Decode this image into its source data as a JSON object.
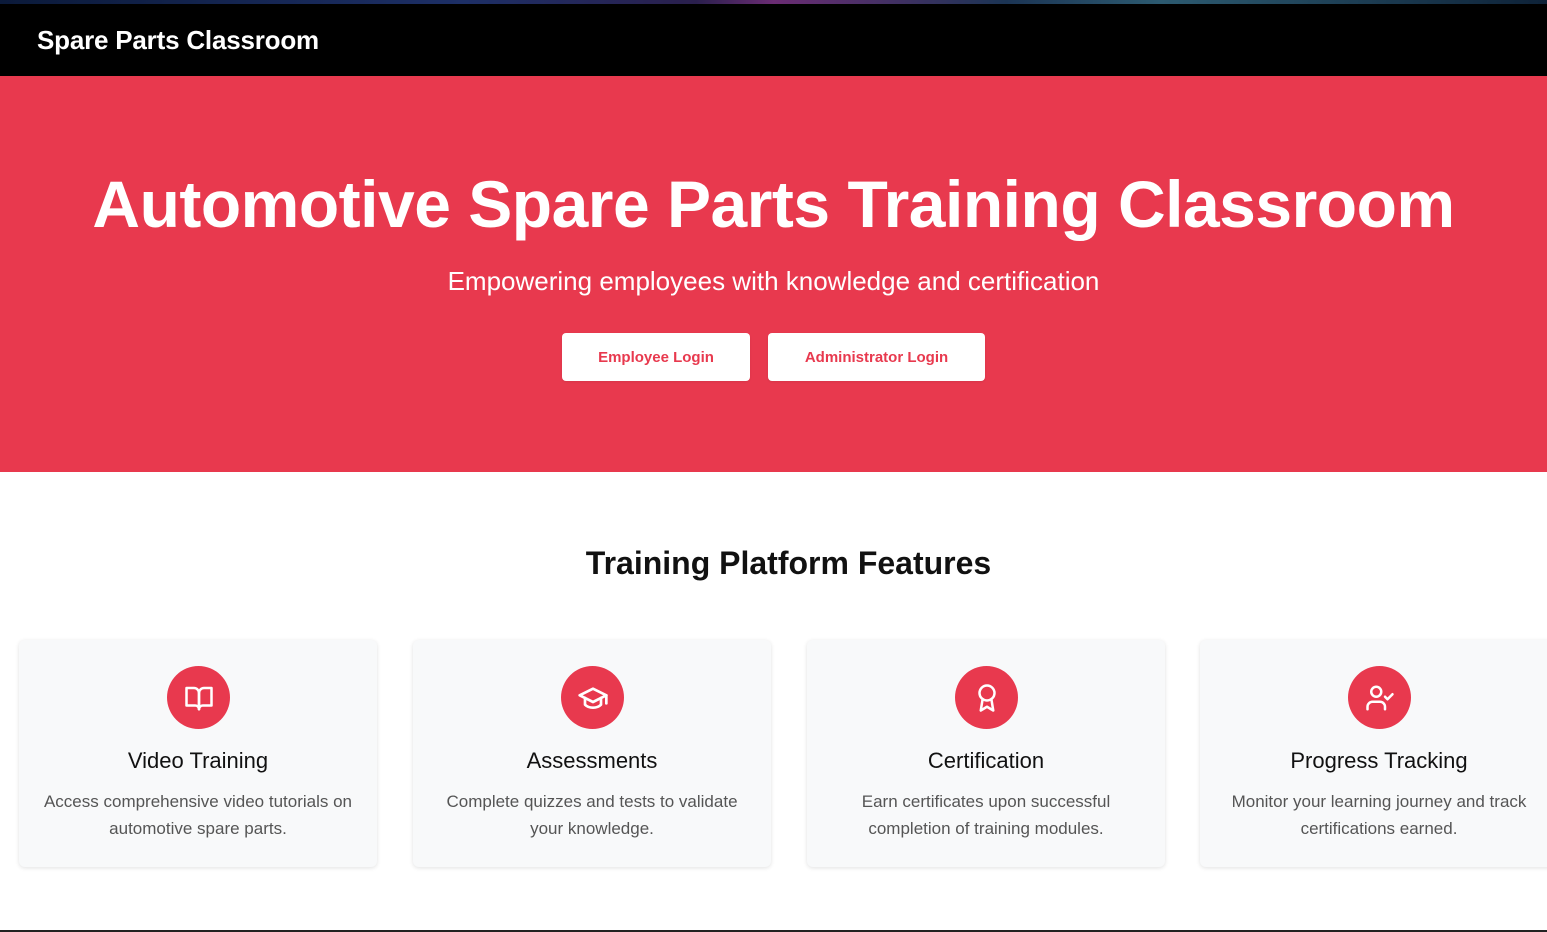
{
  "navbar": {
    "brand": "Spare Parts Classroom"
  },
  "hero": {
    "title": "Automotive Spare Parts Training Classroom",
    "subtitle": "Empowering employees with knowledge and certification",
    "buttons": {
      "employee_login": "Employee Login",
      "admin_login": "Administrator Login"
    }
  },
  "features": {
    "title": "Training Platform Features",
    "items": [
      {
        "icon": "book-open-icon",
        "title": "Video Training",
        "description": "Access comprehensive video tutorials on automotive spare parts."
      },
      {
        "icon": "graduation-cap-icon",
        "title": "Assessments",
        "description": "Complete quizzes and tests to validate your knowledge."
      },
      {
        "icon": "award-icon",
        "title": "Certification",
        "description": "Earn certificates upon successful completion of training modules."
      },
      {
        "icon": "user-check-icon",
        "title": "Progress Tracking",
        "description": "Monitor your learning journey and track certifications earned."
      }
    ]
  },
  "colors": {
    "accent": "#e8394e",
    "navbar": "#000000",
    "card_bg": "#f8f9fa"
  }
}
